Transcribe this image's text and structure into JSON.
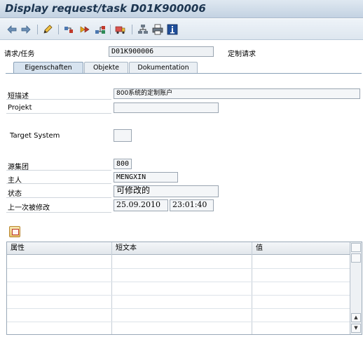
{
  "window": {
    "title": "Display request/task D01K900006"
  },
  "toolbar": {
    "icons": [
      "back-arrow-icon",
      "forward-arrow-icon",
      "pencil-icon",
      "object-list-icon",
      "release-icon",
      "tree-icon",
      "truck-icon",
      "hierarchy-icon",
      "print-icon",
      "info-icon"
    ]
  },
  "header": {
    "request_label": "请求/任务",
    "request_value": "D01K900006",
    "request_type": "定制请求"
  },
  "tabs": [
    {
      "label": "Eigenschaften",
      "active": true
    },
    {
      "label": "Objekte",
      "active": false
    },
    {
      "label": "Dokumentation",
      "active": false
    }
  ],
  "properties": {
    "short_desc_label": "短描述",
    "short_desc_value": "800系统的定制账户",
    "project_label": "Projekt",
    "project_value": "",
    "target_system_label": "Target System",
    "target_system_value": "",
    "source_client_label": "源集团",
    "source_client_value": "800",
    "owner_label": "主人",
    "owner_value": "MENGXIN",
    "status_label": "状态",
    "status_value": "可修改的",
    "last_changed_label": "上一次被修改",
    "last_changed_date": "25.09.2010",
    "last_changed_time": "23:01:40"
  },
  "attributes_table": {
    "headers": [
      "属性",
      "短文本",
      "值"
    ],
    "rows": []
  }
}
